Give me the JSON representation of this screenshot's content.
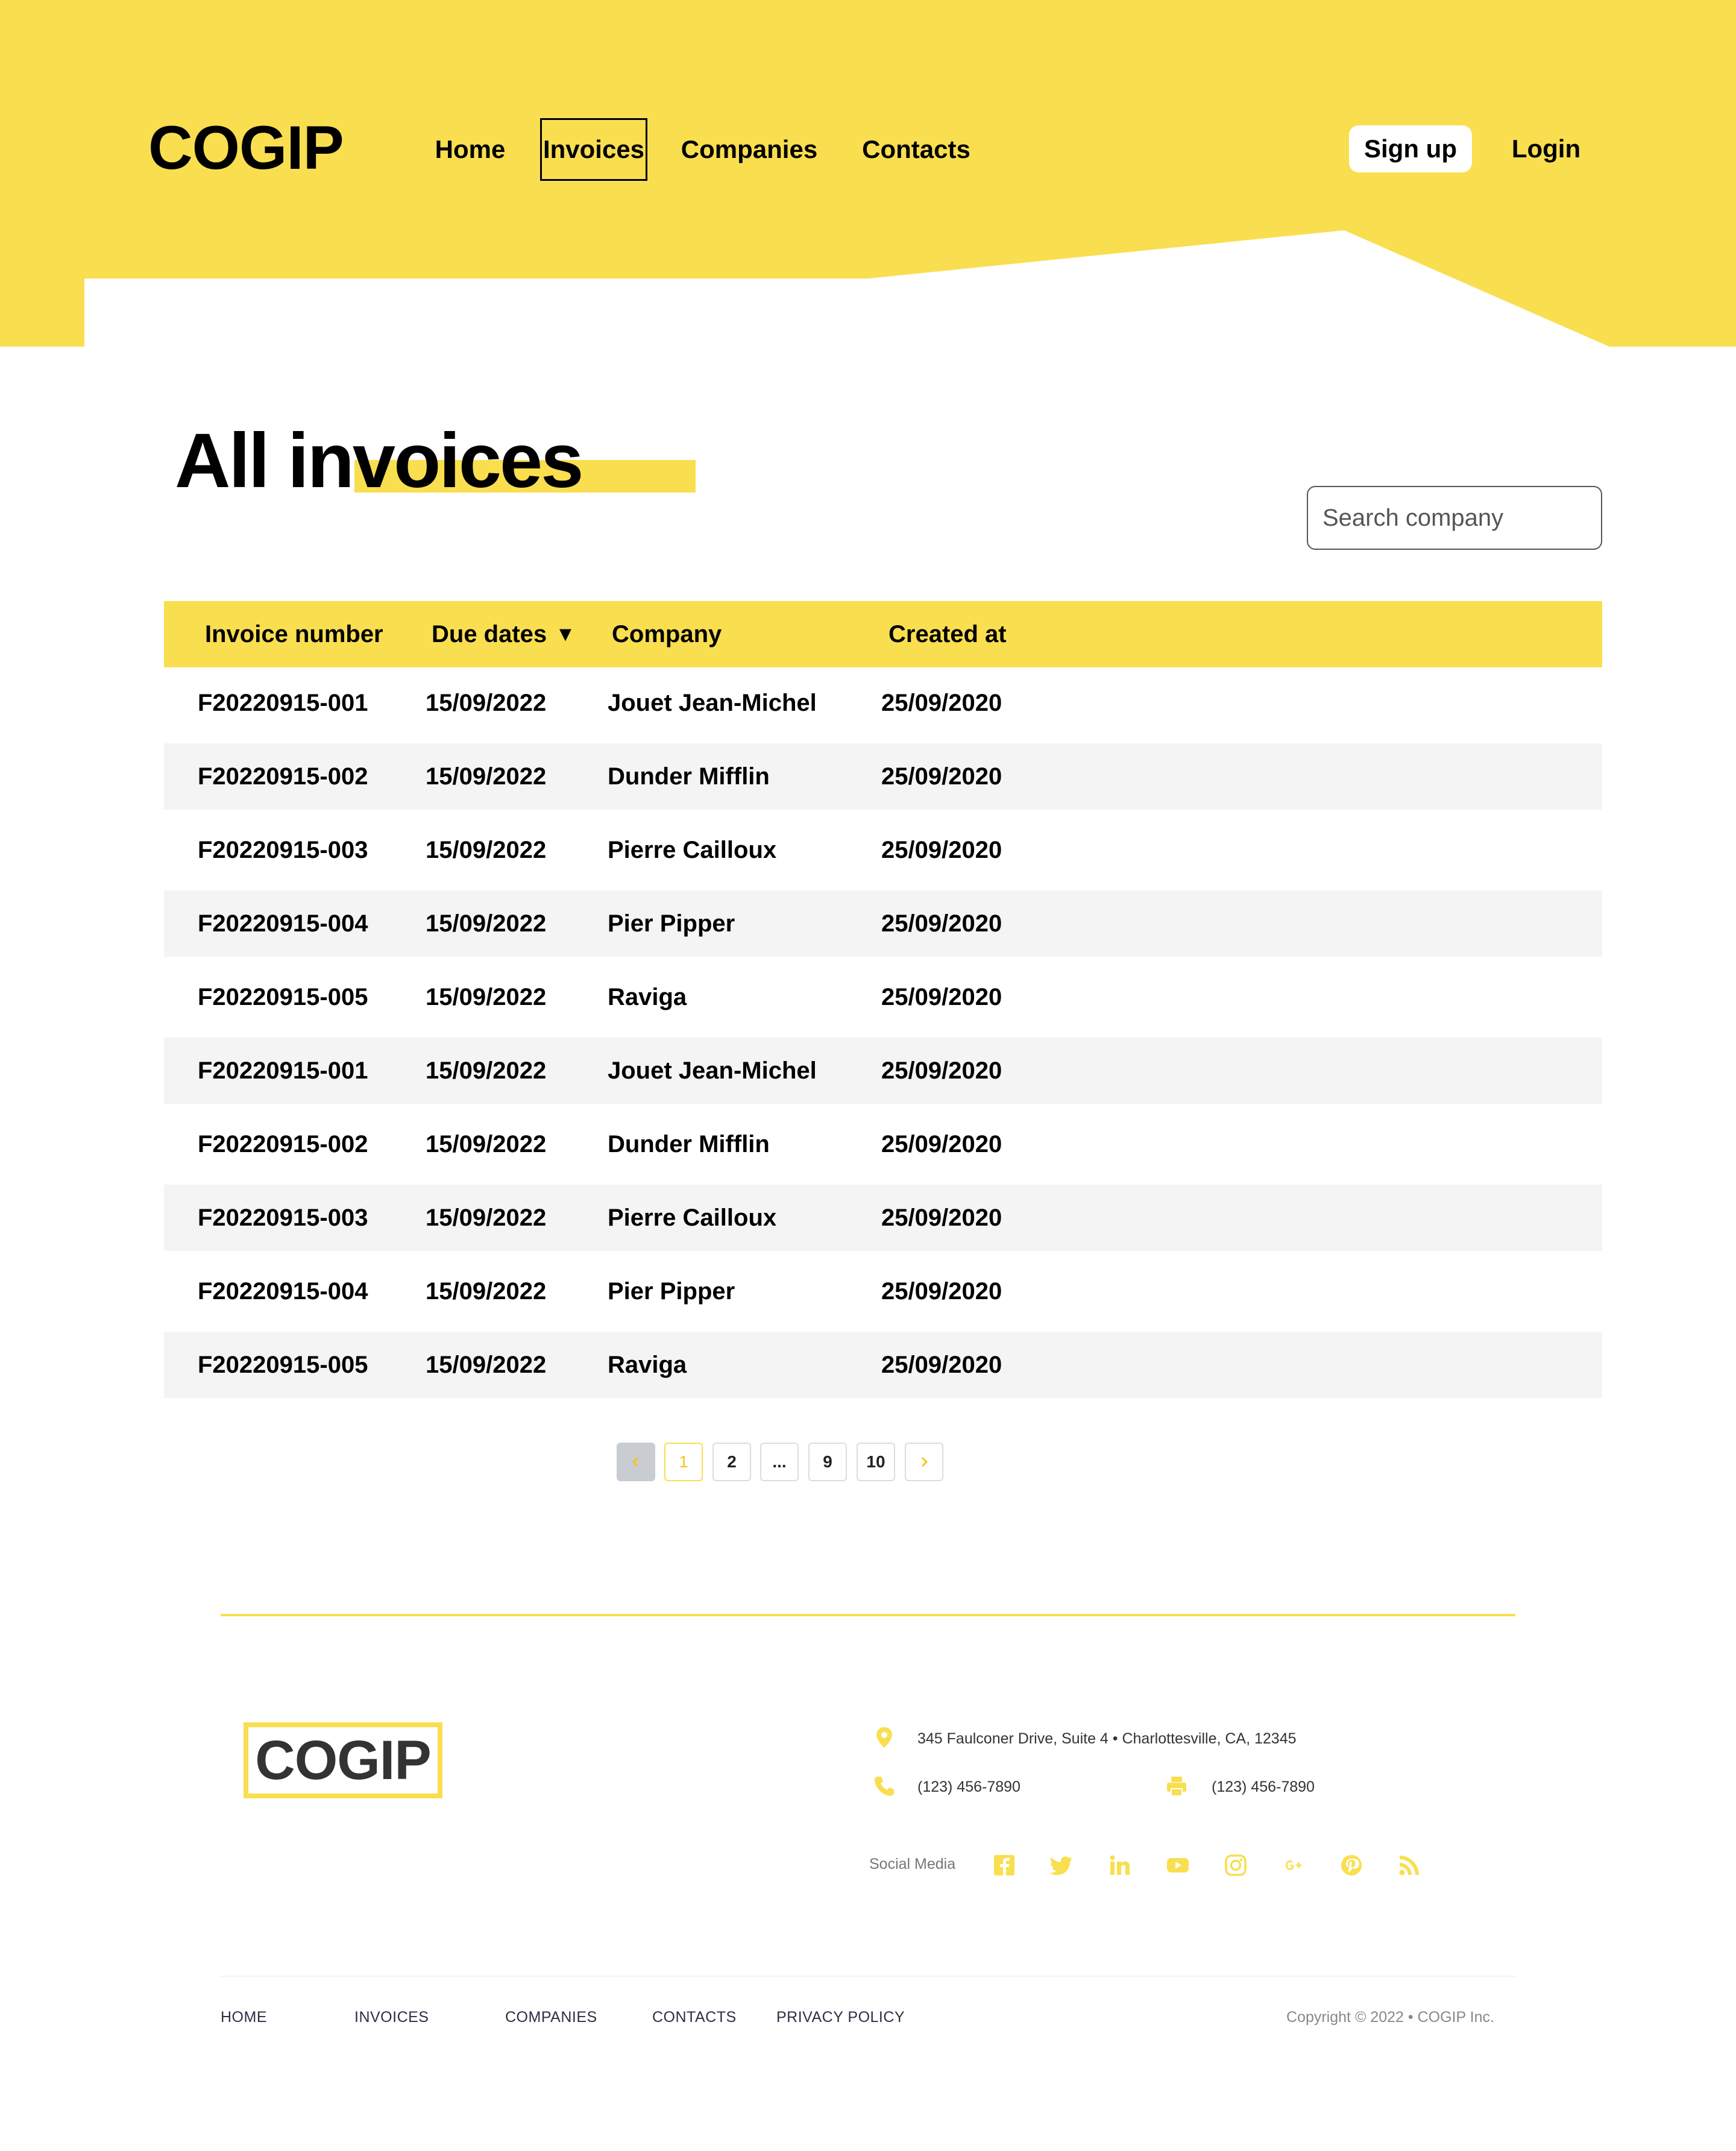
{
  "header": {
    "logo": "COGIP",
    "nav": [
      "Home",
      "Invoices",
      "Companies",
      "Contacts"
    ],
    "signup_label": "Sign up",
    "login_label": "Login"
  },
  "main": {
    "title": "All invoices",
    "search_placeholder": "Search company"
  },
  "table": {
    "columns": [
      "Invoice number",
      "Due dates",
      "Company",
      "Created at"
    ],
    "sort_indicator": "▼",
    "rows": [
      [
        "F20220915-001",
        "15/09/2022",
        "Jouet Jean-Michel",
        "25/09/2020"
      ],
      [
        "F20220915-002",
        "15/09/2022",
        "Dunder Mifflin",
        "25/09/2020"
      ],
      [
        "F20220915-003",
        "15/09/2022",
        "Pierre Cailloux",
        "25/09/2020"
      ],
      [
        "F20220915-004",
        "15/09/2022",
        "Pier Pipper",
        "25/09/2020"
      ],
      [
        "F20220915-005",
        "15/09/2022",
        "Raviga",
        "25/09/2020"
      ],
      [
        "F20220915-001",
        "15/09/2022",
        "Jouet Jean-Michel",
        "25/09/2020"
      ],
      [
        "F20220915-002",
        "15/09/2022",
        "Dunder Mifflin",
        "25/09/2020"
      ],
      [
        "F20220915-003",
        "15/09/2022",
        "Pierre Cailloux",
        "25/09/2020"
      ],
      [
        "F20220915-004",
        "15/09/2022",
        "Pier Pipper",
        "25/09/2020"
      ],
      [
        "F20220915-005",
        "15/09/2022",
        "Raviga",
        "25/09/2020"
      ]
    ]
  },
  "pagination": {
    "prev_icon": "chevron-left-icon",
    "pages": [
      "1",
      "2",
      "...",
      "9",
      "10"
    ],
    "current": "1",
    "next_icon": "chevron-right-icon"
  },
  "footer": {
    "logo": "COGIP",
    "address": "345 Faulconer Drive, Suite 4 • Charlottesville, CA, 12345",
    "phone": "(123) 456-7890",
    "fax": "(123) 456-7890",
    "social_label": "Social Media",
    "social_icons": [
      "facebook-icon",
      "twitter-icon",
      "linkedin-icon",
      "youtube-icon",
      "instagram-icon",
      "google-plus-icon",
      "pinterest-icon",
      "rss-icon"
    ],
    "links": [
      "HOME",
      "INVOICES",
      "COMPANIES",
      "CONTACTS",
      "PRIVACY POLICY"
    ],
    "copyright": "Copyright © 2022 • COGIP Inc."
  },
  "colors": {
    "accent": "#f9de4f",
    "row_alt": "#f4f4f4",
    "text": "#000000"
  }
}
